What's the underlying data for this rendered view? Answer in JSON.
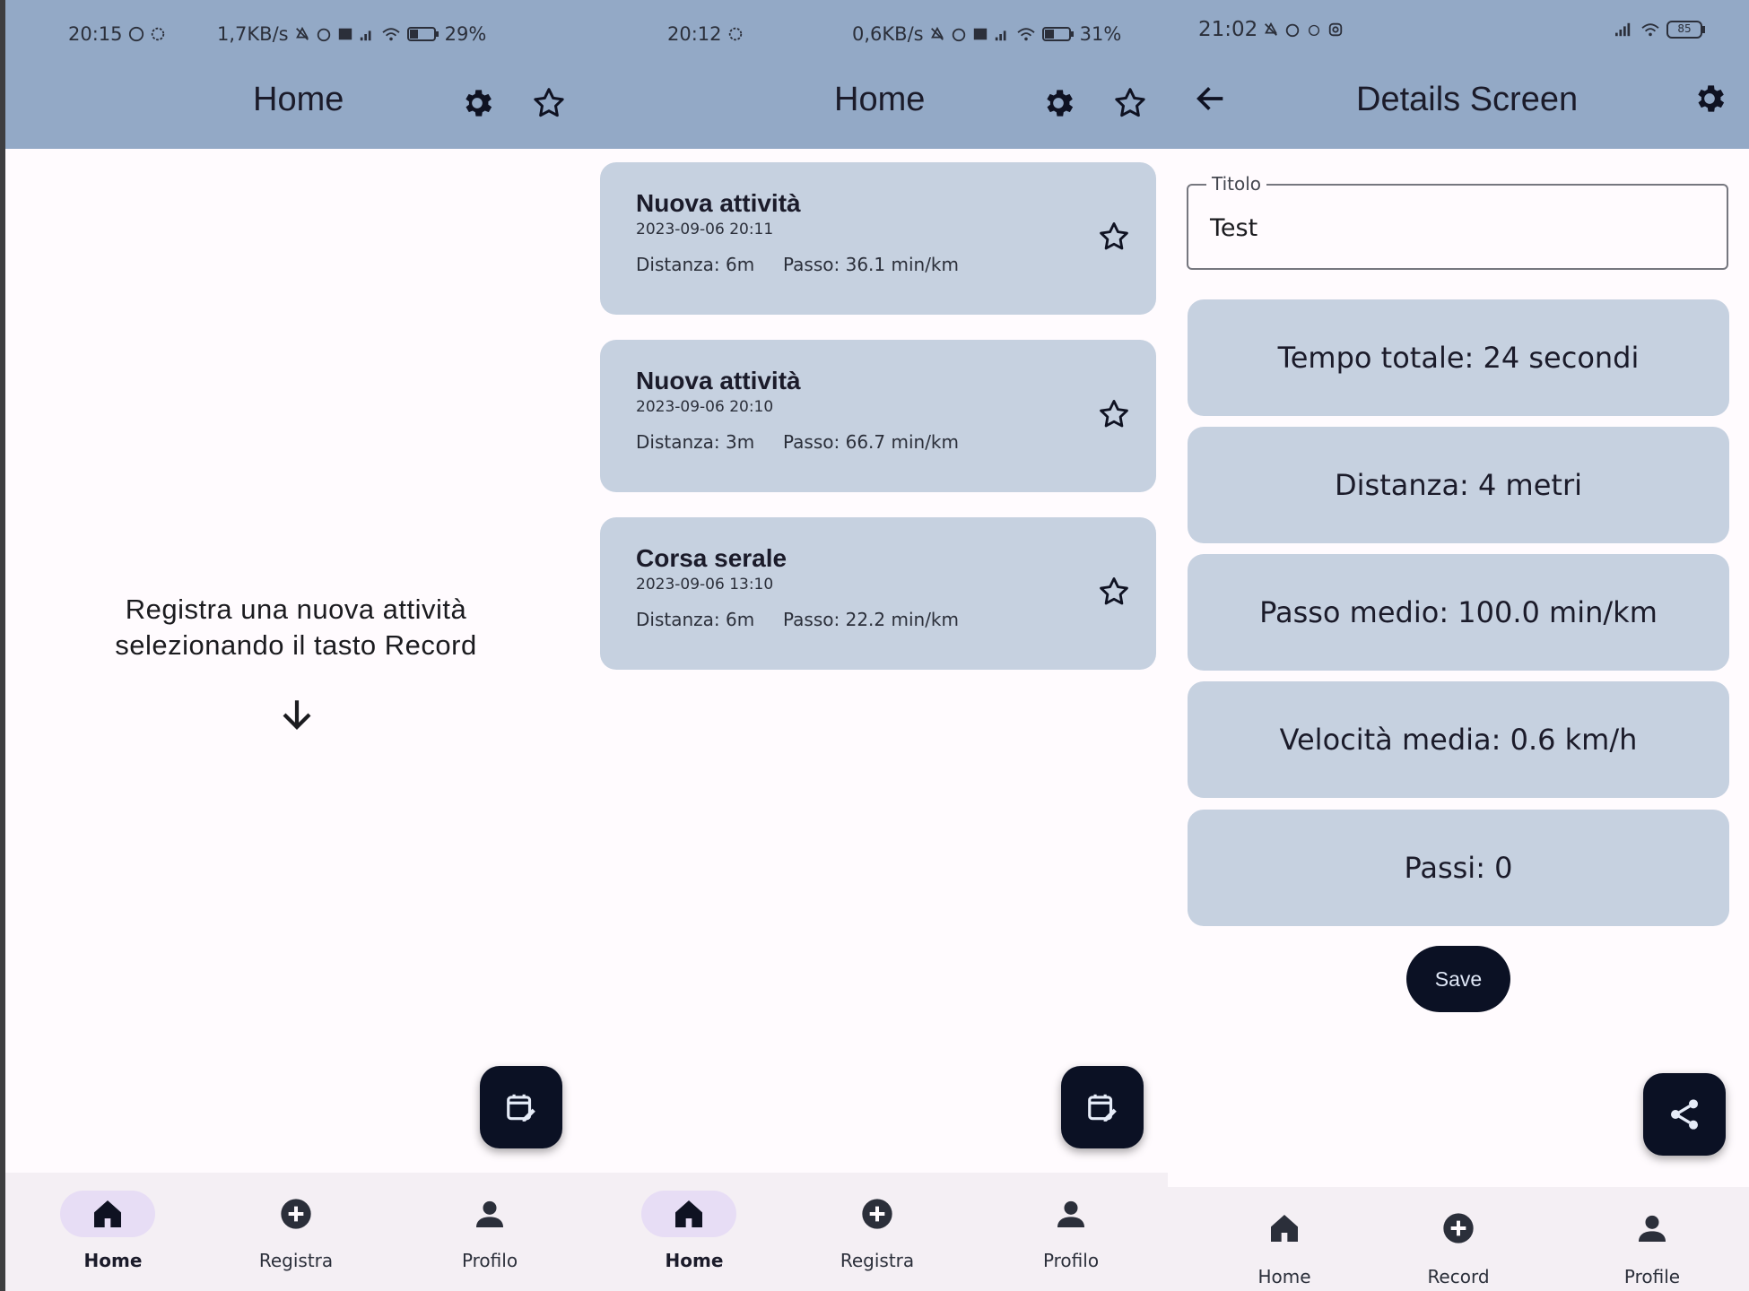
{
  "screens": [
    {
      "status": {
        "time": "20:15",
        "net": "1,7KB/s",
        "battery": "29%"
      },
      "appbar": {
        "title": "Home"
      },
      "empty": {
        "line1": "Registra una nuova attività",
        "line2": "selezionando il tasto Record"
      },
      "nav": [
        {
          "label": "Home",
          "icon": "home-icon",
          "active": true
        },
        {
          "label": "Registra",
          "icon": "add-circle-icon",
          "active": false
        },
        {
          "label": "Profilo",
          "icon": "person-icon",
          "active": false
        }
      ]
    },
    {
      "status": {
        "time": "20:12",
        "net": "0,6KB/s",
        "battery": "31%"
      },
      "appbar": {
        "title": "Home"
      },
      "activities": [
        {
          "title": "Nuova attività",
          "date": "2023-09-06 20:11",
          "distance": "Distanza: 6m",
          "pace": "Passo: 36.1 min/km"
        },
        {
          "title": "Nuova attività",
          "date": "2023-09-06 20:10",
          "distance": "Distanza: 3m",
          "pace": "Passo: 66.7 min/km"
        },
        {
          "title": "Corsa serale",
          "date": "2023-09-06 13:10",
          "distance": "Distanza: 6m",
          "pace": "Passo: 22.2 min/km"
        }
      ],
      "nav": [
        {
          "label": "Home",
          "icon": "home-icon",
          "active": true
        },
        {
          "label": "Registra",
          "icon": "add-circle-icon",
          "active": false
        },
        {
          "label": "Profilo",
          "icon": "person-icon",
          "active": false
        }
      ]
    },
    {
      "status": {
        "time": "21:02",
        "battery": "85"
      },
      "appbar": {
        "title": "Details Screen"
      },
      "title_field": {
        "label": "Titolo",
        "value": "Test"
      },
      "stats": [
        "Tempo totale: 24 secondi",
        "Distanza: 4 metri",
        "Passo medio: 100.0 min/km",
        "Velocità media: 0.6 km/h",
        "Passi: 0"
      ],
      "save_label": "Save",
      "nav": [
        {
          "label": "Home",
          "icon": "home-icon",
          "active": false
        },
        {
          "label": "Record",
          "icon": "add-circle-icon",
          "active": false
        },
        {
          "label": "Profile",
          "icon": "person-icon",
          "active": false
        }
      ]
    }
  ],
  "colors": {
    "appbar": "#93a9c6",
    "card": "#c6d1e0",
    "fab": "#0b1124",
    "nav_pill": "#e7ddf5",
    "background": "#fffbfe"
  }
}
